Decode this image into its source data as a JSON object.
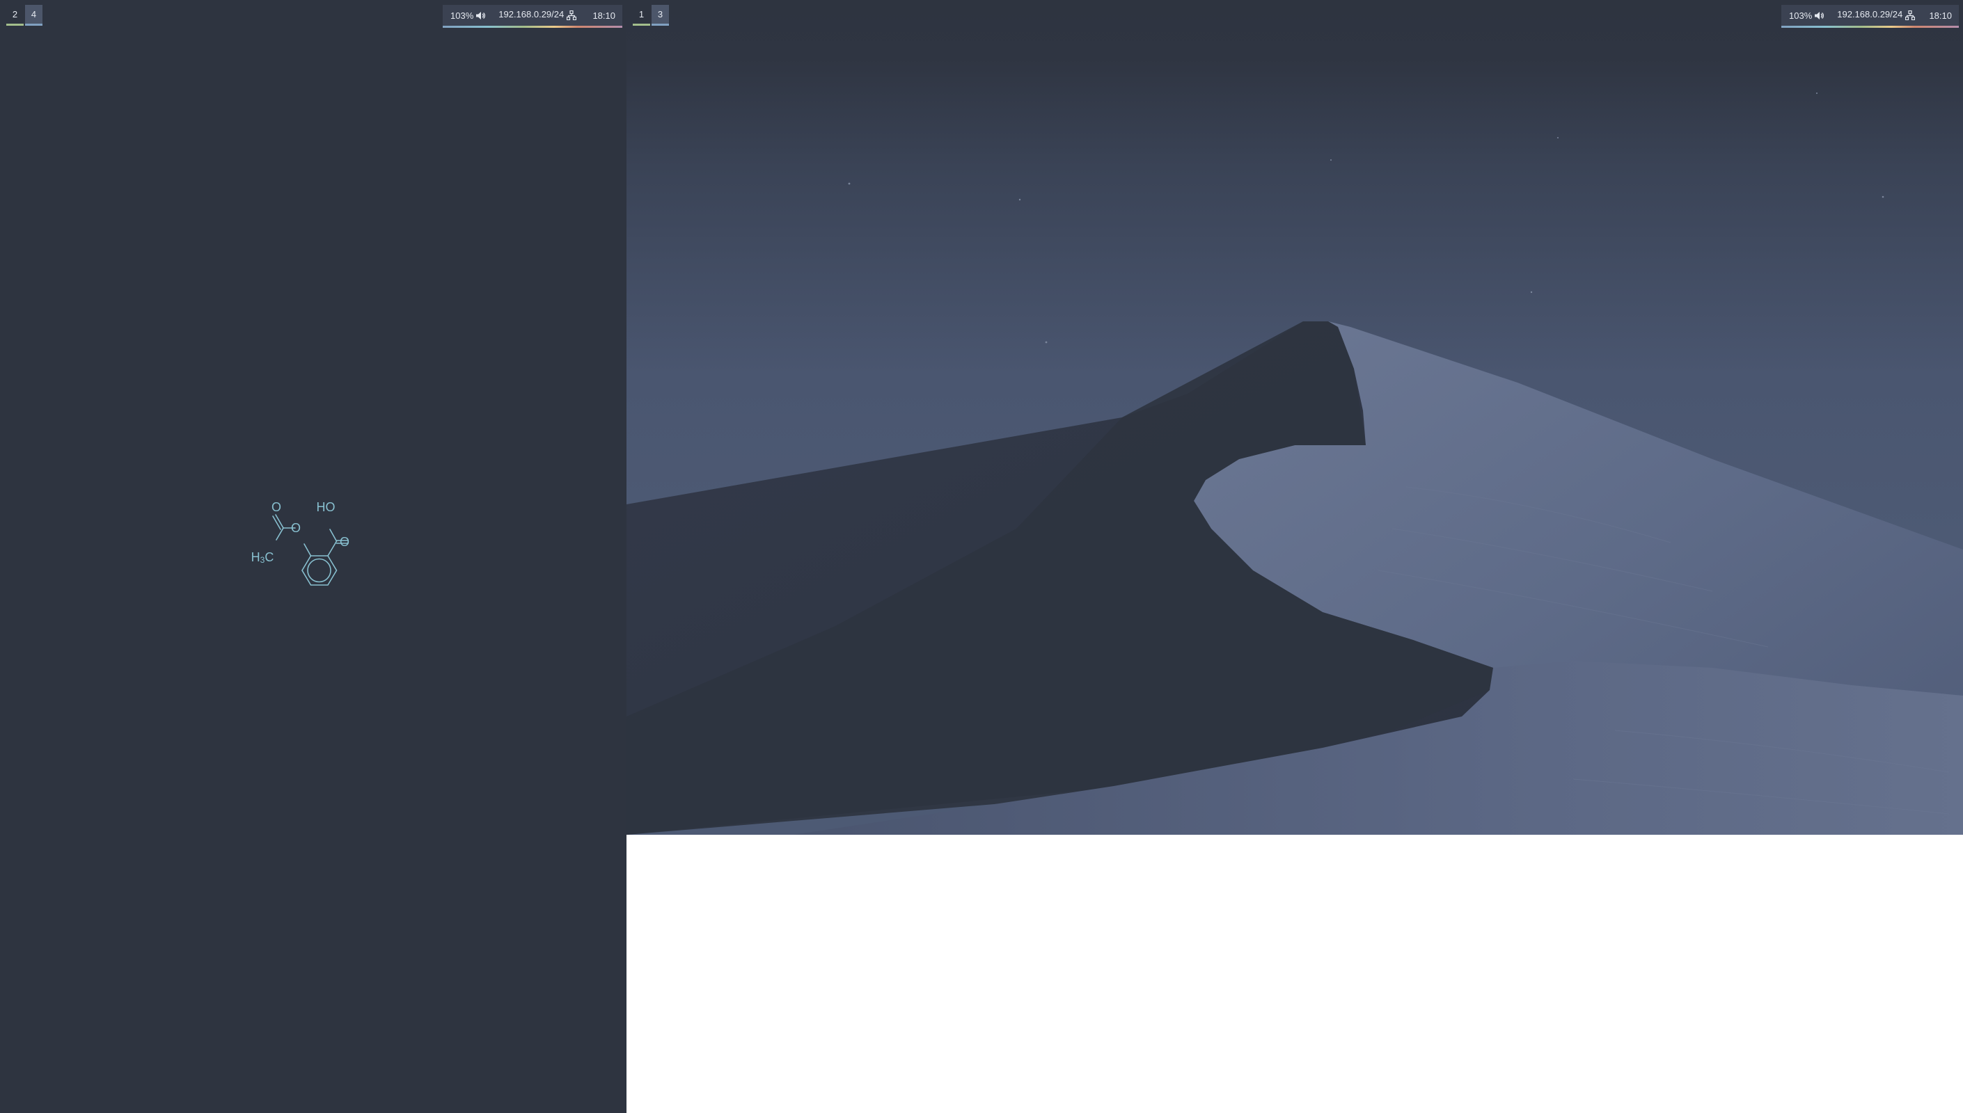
{
  "desktop": {
    "left_monitor": {
      "workspaces": [
        {
          "label": "2",
          "active": false
        },
        {
          "label": "4",
          "active": true
        }
      ],
      "status": {
        "volume_percent": "103%",
        "volume_icon": "speaker-icon",
        "ip_address": "192.168.0.29/24",
        "network_icon": "network-icon",
        "clock": "18:10"
      },
      "wallpaper": {
        "type": "chemical-structure",
        "color": "#88c0d0",
        "labels": {
          "carbonyl_o": "O",
          "ester_o": "O",
          "hydroxyl": "HO",
          "acid_o": "O",
          "methyl_h": "H",
          "methyl_sub": "3",
          "methyl_c": "C"
        }
      }
    },
    "right_monitor": {
      "workspaces": [
        {
          "label": "1",
          "active": false
        },
        {
          "label": "3",
          "active": true
        }
      ],
      "status": {
        "volume_percent": "103%",
        "volume_icon": "speaker-icon",
        "ip_address": "192.168.0.29/24",
        "network_icon": "network-icon",
        "clock": "18:10"
      },
      "wallpaper": {
        "type": "desert-dunes-night"
      }
    }
  },
  "colors": {
    "background": "#2e3440",
    "bar_background": "#3b4252",
    "workspace_active": "#4c566a",
    "accent_green": "#a3be8c",
    "accent_blue": "#81a1c1",
    "text": "#e5e9f0",
    "molecule": "#88c0d0"
  }
}
